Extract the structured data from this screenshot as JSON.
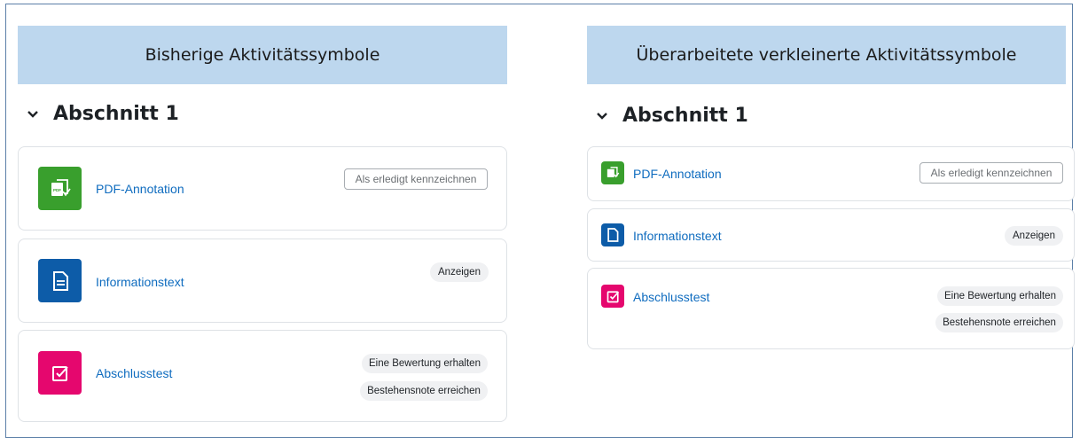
{
  "left": {
    "banner_title": "Bisherige Aktivitätssymbole",
    "section_title": "Abschnitt 1",
    "activities": [
      {
        "name": "PDF-Annotation",
        "icon": "pdf-annotation-icon",
        "action": "Als erledigt kennzeichnen"
      },
      {
        "name": "Informationstext",
        "icon": "page-icon",
        "badge": "Anzeigen"
      },
      {
        "name": "Abschlusstest",
        "icon": "quiz-icon",
        "badges": [
          "Eine Bewertung erhalten",
          "Bestehensnote erreichen"
        ]
      }
    ]
  },
  "right": {
    "banner_title": "Überarbeitete verkleinerte Aktivitätssymbole",
    "section_title": "Abschnitt 1",
    "activities": [
      {
        "name": "PDF-Annotation",
        "icon": "pdf-annotation-icon",
        "action": "Als erledigt kennzeichnen"
      },
      {
        "name": "Informationstext",
        "icon": "page-icon",
        "badge": "Anzeigen"
      },
      {
        "name": "Abschlusstest",
        "icon": "quiz-icon",
        "badges": [
          "Eine Bewertung erhalten",
          "Bestehensnote erreichen"
        ]
      }
    ]
  },
  "colors": {
    "banner": "#bdd7ee",
    "pdf_icon": "#399f2d",
    "page_icon": "#0d5ca8",
    "quiz_icon": "#e5076e",
    "link": "#0f6cbf"
  }
}
